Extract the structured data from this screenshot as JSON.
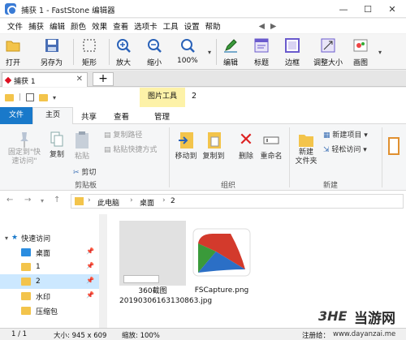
{
  "window": {
    "title": "捕获 1 - FastStone 编辑器",
    "min": "—",
    "max": "☐",
    "close": "✕"
  },
  "menu": [
    "文件",
    "捕获",
    "编辑",
    "颜色",
    "效果",
    "查看",
    "选项卡",
    "工具",
    "设置",
    "帮助",
    "◀",
    "▶"
  ],
  "toolbar": {
    "open": "打开",
    "save_as": "另存为",
    "rect": "矩形",
    "zoom_in": "放大",
    "zoom_out": "缩小",
    "zoom_pct": "100%",
    "edit": "编辑",
    "caption": "标题",
    "border": "边框",
    "resize": "调整大小",
    "canvas": "画图"
  },
  "doc_tab": {
    "label": "捕获 1",
    "close": "✕",
    "add": "+"
  },
  "explorer": {
    "picture_tools": "图片工具",
    "folder_name": "2",
    "tabs": {
      "file": "文件",
      "home": "主页",
      "share": "共享",
      "view": "查看",
      "manage": "管理"
    },
    "ribbon": {
      "pin": "固定到\"快\n速访问\"",
      "copy": "复制",
      "paste": "粘贴",
      "copy_path": "复制路径",
      "paste_shortcut": "粘贴快捷方式",
      "cut": "剪切",
      "clipboard": "剪贴板",
      "move_to": "移动到",
      "copy_to": "复制到",
      "delete": "删除",
      "rename": "重命名",
      "organize": "组织",
      "new_folder": "新建\n文件夹",
      "new_item": "新建项目",
      "easy_access": "轻松访问",
      "new_group": "新建"
    },
    "address": {
      "back": "←",
      "forward": "→",
      "up": "↑",
      "path": [
        "此电脑",
        "桌面",
        "2"
      ]
    },
    "nav": {
      "quick_access": "快速访问",
      "items": [
        "桌面",
        "1",
        "2",
        "水印",
        "压缩包"
      ]
    },
    "files": [
      {
        "name": "360截图\n20190306163130863.jpg"
      },
      {
        "name": "FSCapture.png"
      }
    ]
  },
  "status": {
    "page": "1 / 1",
    "size": "大小: 945 x 609",
    "zoom": "缩放: 100%",
    "annot": "注册给："
  },
  "watermark": {
    "text": "当游网",
    "url": "www.dayanzai.me"
  },
  "colors": {
    "accent": "#1979ca",
    "picture_tools_bg": "#fdf2a8",
    "selected": "#cce8ff"
  }
}
